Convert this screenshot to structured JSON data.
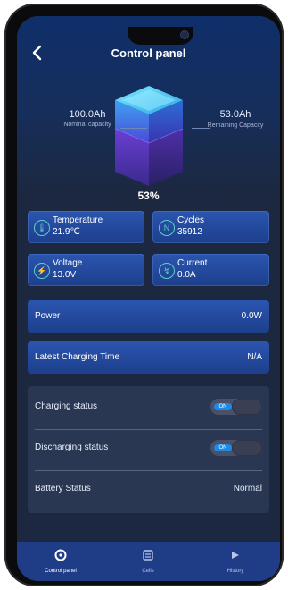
{
  "header": {
    "title": "Control panel"
  },
  "battery": {
    "nominal_value": "100.0Ah",
    "nominal_label": "Nominal capacity",
    "remaining_value": "53.0Ah",
    "remaining_label": "Remaining Capacity",
    "percent": "53%",
    "level": 0.53
  },
  "tiles": {
    "temperature": {
      "label": "Temperature",
      "value": "21.9℃"
    },
    "cycles": {
      "label": "Cycles",
      "value": "35912"
    },
    "voltage": {
      "label": "Voltage",
      "value": "13.0V"
    },
    "current": {
      "label": "Current",
      "value": "0.0A"
    }
  },
  "bars": {
    "power": {
      "label": "Power",
      "value": "0.0W"
    },
    "charging_time": {
      "label": "Latest Charging Time",
      "value": "N/A"
    }
  },
  "status": {
    "charging": {
      "label": "Charging status",
      "toggle_text": "ON"
    },
    "discharging": {
      "label": "Discharging status",
      "toggle_text": "ON"
    },
    "battery": {
      "label": "Battery Status",
      "value": "Normal"
    }
  },
  "nav": [
    {
      "label": "Control panel"
    },
    {
      "label": "Cells"
    },
    {
      "label": "History"
    }
  ],
  "colors": {
    "accent": "#2b55b0",
    "teal": "#5dd0c4",
    "toggle_on": "#1f89e6"
  }
}
